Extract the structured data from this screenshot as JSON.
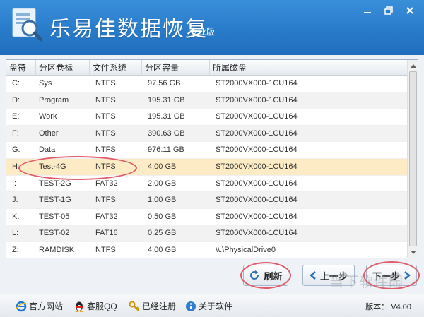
{
  "app": {
    "title": "乐易佳数据恢复",
    "edition": "专业版"
  },
  "window_controls": [
    "minimize-icon",
    "restore-icon",
    "close-icon"
  ],
  "table": {
    "columns": [
      "盘符",
      "分区卷标",
      "文件系统",
      "分区容量",
      "所属磁盘",
      ""
    ],
    "rows": [
      {
        "drive": "C:",
        "label": "Sys",
        "fs": "NTFS",
        "size": "97.56 GB",
        "disk": "ST2000VX000-1CU164"
      },
      {
        "drive": "D:",
        "label": "Program",
        "fs": "NTFS",
        "size": "195.31 GB",
        "disk": "ST2000VX000-1CU164"
      },
      {
        "drive": "E:",
        "label": "Work",
        "fs": "NTFS",
        "size": "195.31 GB",
        "disk": "ST2000VX000-1CU164"
      },
      {
        "drive": "F:",
        "label": "Other",
        "fs": "NTFS",
        "size": "390.63 GB",
        "disk": "ST2000VX000-1CU164"
      },
      {
        "drive": "G:",
        "label": "Data",
        "fs": "NTFS",
        "size": "976.11 GB",
        "disk": "ST2000VX000-1CU164"
      },
      {
        "drive": "H:",
        "label": "Test-4G",
        "fs": "NTFS",
        "size": "4.00 GB",
        "disk": "ST2000VX000-1CU164"
      },
      {
        "drive": "I:",
        "label": "TEST-2G",
        "fs": "FAT32",
        "size": "2.00 GB",
        "disk": "ST2000VX000-1CU164"
      },
      {
        "drive": "J:",
        "label": "TEST-1G",
        "fs": "NTFS",
        "size": "1.00 GB",
        "disk": "ST2000VX000-1CU164"
      },
      {
        "drive": "K:",
        "label": "TEST-05",
        "fs": "FAT32",
        "size": "0.50 GB",
        "disk": "ST2000VX000-1CU164"
      },
      {
        "drive": "L:",
        "label": "TEST-02",
        "fs": "FAT16",
        "size": "0.25 GB",
        "disk": "ST2000VX000-1CU164"
      },
      {
        "drive": "Z:",
        "label": "RAMDISK",
        "fs": "NTFS",
        "size": "4.00 GB",
        "disk": "\\\\.\\PhysicalDrive0"
      }
    ],
    "selected_index": 5
  },
  "buttons": {
    "refresh": "刷新",
    "prev": "上一步",
    "next": "下一步"
  },
  "statusbar": {
    "website": "官方网站",
    "qq": "客服QQ",
    "registered": "已经注册",
    "about": "关于软件",
    "version": "版本： V4.00"
  },
  "watermark": "当下软件园",
  "colors": {
    "header": "#2a7dcb",
    "selected_row": "#fdebc6",
    "annotation": "#e05a6a"
  }
}
